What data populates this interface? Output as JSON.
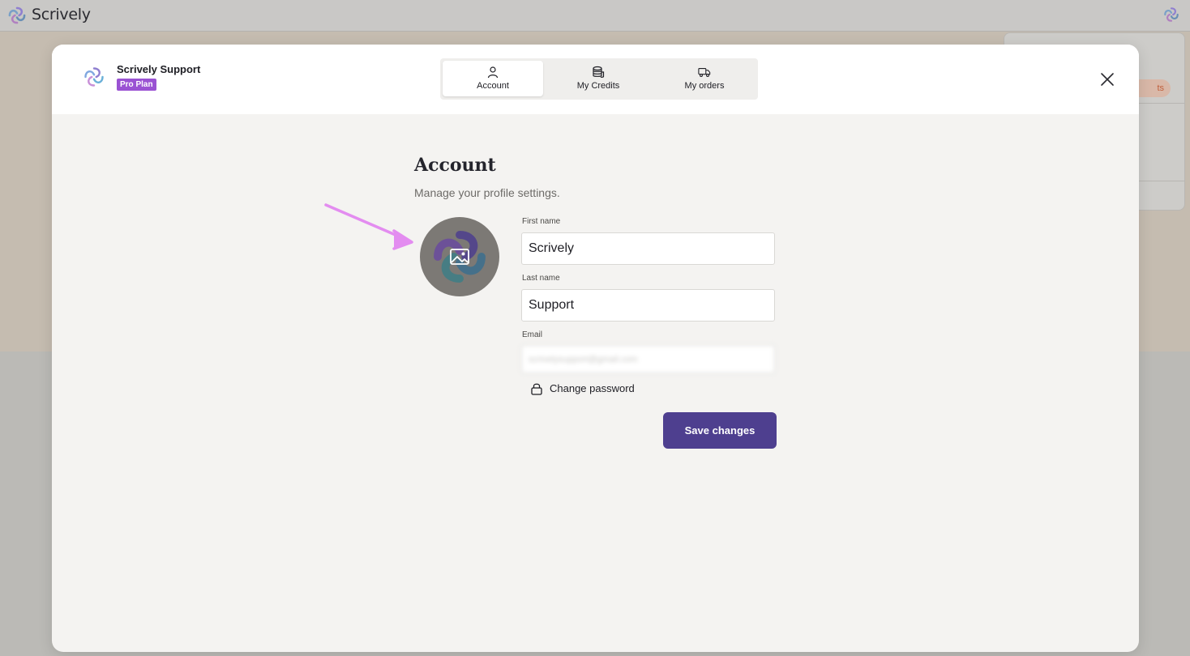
{
  "app": {
    "name": "Scrively"
  },
  "background": {
    "pill_text": "ts"
  },
  "header": {
    "user_name": "Scrively Support",
    "plan_badge": "Pro Plan",
    "tabs": [
      {
        "label": "Account",
        "icon": "user-icon",
        "active": true
      },
      {
        "label": "My Credits",
        "icon": "coins-icon",
        "active": false
      },
      {
        "label": "My orders",
        "icon": "truck-icon",
        "active": false
      }
    ],
    "close_icon": "close-icon"
  },
  "account": {
    "title": "Account",
    "subtitle": "Manage your profile settings.",
    "avatar_upload_icon": "image-icon",
    "fields": {
      "first_name": {
        "label": "First name",
        "value": "Scrively"
      },
      "last_name": {
        "label": "Last name",
        "value": "Support"
      },
      "email": {
        "label": "Email",
        "value": "scrivelysupport@gmail.com",
        "blurred": true
      }
    },
    "change_password": "Change password",
    "save_label": "Save changes"
  },
  "colors": {
    "accent": "#4e3f8f",
    "badge": "#9a52d3",
    "annotation_arrow": "#e38cf0"
  }
}
